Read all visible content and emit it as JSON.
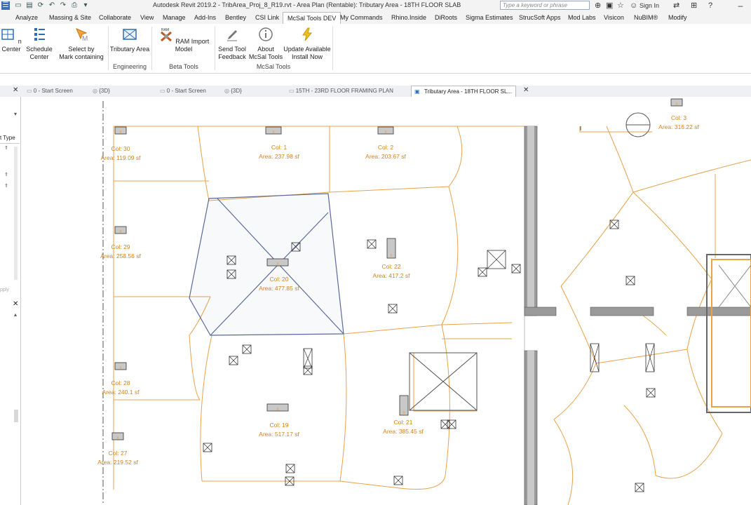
{
  "app": {
    "title": "Autodesk Revit 2019.2 - TribArea_Proj_8_R19.rvt - Area Plan (Rentable): Tributary Area - 18TH FLOOR SLAB",
    "search_placeholder": "Type a keyword or phrase",
    "sign_in": "Sign In"
  },
  "ribbon_tabs": [
    "Analyze",
    "Massing & Site",
    "Collaborate",
    "View",
    "Manage",
    "Add-Ins",
    "Bentley",
    "CSI Link",
    "McSal Tools DEV",
    "My Commands",
    "Rhino.Inside",
    "DiRoots",
    "Sigma Estimates",
    "StrucSoft Apps",
    "Mod Labs",
    "Visicon",
    "NuBIM®",
    "Modify"
  ],
  "ribbon_active_tab": "McSal Tools DEV",
  "ribbon": {
    "buttons": [
      {
        "label1": "n Center",
        "label2": "",
        "icon": "center-icon"
      },
      {
        "label1": "Schedule",
        "label2": "Center",
        "icon": "schedule-icon"
      },
      {
        "label1": "Select by",
        "label2": "Mark containing",
        "icon": "select-mark-icon"
      },
      {
        "label1": "Tributary Area",
        "label2": "",
        "icon": "tributary-area-icon"
      },
      {
        "label1": "RAM Import Model",
        "label2": "",
        "icon": "ram-import-icon"
      },
      {
        "label1": "Send Tool",
        "label2": "Feedback",
        "icon": "feedback-icon"
      },
      {
        "label1": "About",
        "label2": "McSal Tools",
        "icon": "info-icon"
      },
      {
        "label1": "Update Available",
        "label2": "Install Now",
        "icon": "update-icon"
      }
    ],
    "panels": [
      "Engineering",
      "Beta Tools",
      "McSal Tools"
    ],
    "ram_badge": "RAM"
  },
  "doc_tabs": [
    {
      "label": "0 - Start Screen",
      "active": false
    },
    {
      "label": "{3D}",
      "active": false
    },
    {
      "label": "0 - Start Screen",
      "active": false
    },
    {
      "label": "{3D}",
      "active": false
    },
    {
      "label": "15TH - 23RD FLOOR FRAMING PLAN",
      "active": false
    },
    {
      "label": "Tributary Area - 18TH FLOOR SL...",
      "active": true
    }
  ],
  "left_panel": {
    "type_label": "t Type",
    "apply_label": "pply"
  },
  "columns": [
    {
      "name": "Col: 30",
      "area": "Area: 119.09 sf"
    },
    {
      "name": "Col: 1",
      "area": "Area: 237.98 sf"
    },
    {
      "name": "Col: 2",
      "area": "Area: 203.67 sf"
    },
    {
      "name": "Col: 3",
      "area": "Area: 316.22 sf"
    },
    {
      "name": "Col: 29",
      "area": "Area: 258.56 sf"
    },
    {
      "name": "Col: 20",
      "area": "Area: 477.85 sf"
    },
    {
      "name": "Col: 22",
      "area": "Area: 417.2 sf"
    },
    {
      "name": "Col: 28",
      "area": "Area: 240.1 sf"
    },
    {
      "name": "Col: 19",
      "area": "Area: 517.17 sf"
    },
    {
      "name": "Col: 21",
      "area": "Area: 385.45 sf"
    },
    {
      "name": "Col: 27",
      "area": "Area: 219.52 sf"
    }
  ],
  "colors": {
    "area_line": "#e8a24a",
    "label": "#d4821a",
    "wall": "#8a8a8a",
    "selected": "#5a6a9a"
  }
}
